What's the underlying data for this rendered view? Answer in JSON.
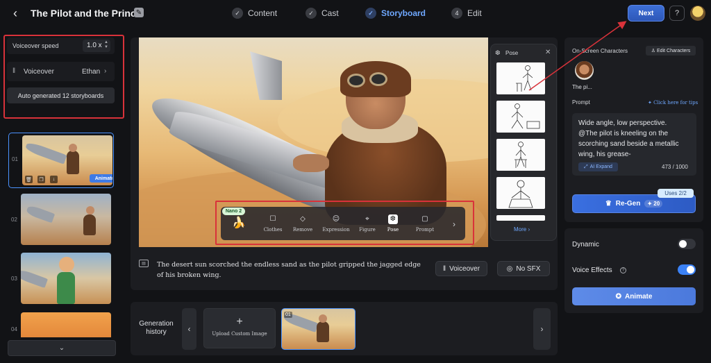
{
  "header": {
    "title": "The Pilot and the Prince",
    "steps": [
      {
        "num": "✓",
        "label": "Content"
      },
      {
        "num": "✓",
        "label": "Cast"
      },
      {
        "num": "✓",
        "label": "Storyboard"
      },
      {
        "num": "4",
        "label": "Edit"
      }
    ],
    "next_label": "Next",
    "help_label": "?"
  },
  "left_panel": {
    "voiceover_speed_label": "Voiceover speed",
    "voiceover_speed_value": "1.0 x",
    "voiceover_label": "Voiceover",
    "voiceover_voice": "Ethan",
    "autogen_label": "Auto generated 12 storyboards",
    "storyboards": [
      {
        "num": "01",
        "action": "Animate"
      },
      {
        "num": "02"
      },
      {
        "num": "03"
      },
      {
        "num": "04"
      }
    ]
  },
  "toolbar": {
    "badge": "Nano 2",
    "tools": [
      {
        "label": "Clothes",
        "icon": "shirt-icon",
        "glyph": "☐"
      },
      {
        "label": "Remove",
        "icon": "eraser-icon",
        "glyph": "◇"
      },
      {
        "label": "Expression",
        "icon": "smiley-icon",
        "glyph": "☺"
      },
      {
        "label": "Figure",
        "icon": "figure-frame-icon",
        "glyph": "⌖"
      },
      {
        "label": "Pose",
        "icon": "pose-icon",
        "glyph": "❆"
      },
      {
        "label": "Prompt",
        "icon": "prompt-icon",
        "glyph": "▢"
      }
    ],
    "active_tool": "Pose"
  },
  "pose_panel": {
    "title": "Pose",
    "more_label": "More ›",
    "cards": 5
  },
  "caption": {
    "text": "The desert sun scorched the endless sand as the pilot gripped the jagged edge of his broken wing.",
    "voiceover_label": "Voiceover",
    "sfx_label": "No SFX"
  },
  "generation_history": {
    "label": "Generation history",
    "upload_label": "Upload Custom Image",
    "items": [
      {
        "num": "01"
      }
    ]
  },
  "right_panel": {
    "characters_title": "On-Screen Characters",
    "edit_characters_label": "Edit Characters",
    "character_name": "The pi...",
    "prompt_label": "Prompt",
    "tips_label": "Click here for tips",
    "prompt_text": "Wide angle, low perspective. @The pilot is kneeling on the scorching sand beside a metallic wing, his grease-",
    "ai_expand_label": "AI Expand",
    "char_count": "473 / 1000",
    "uses_label": "Uses  2/2",
    "regen_label": "Re-Gen",
    "regen_credit": "20",
    "dynamic_label": "Dynamic",
    "dynamic_on": false,
    "voice_effects_label": "Voice Effects",
    "voice_effects_on": true,
    "animate_label": "Animate"
  },
  "colors": {
    "accent": "#3b82f6",
    "highlight_box": "#d9323a",
    "background": "#121316",
    "card": "#1c1d21"
  }
}
